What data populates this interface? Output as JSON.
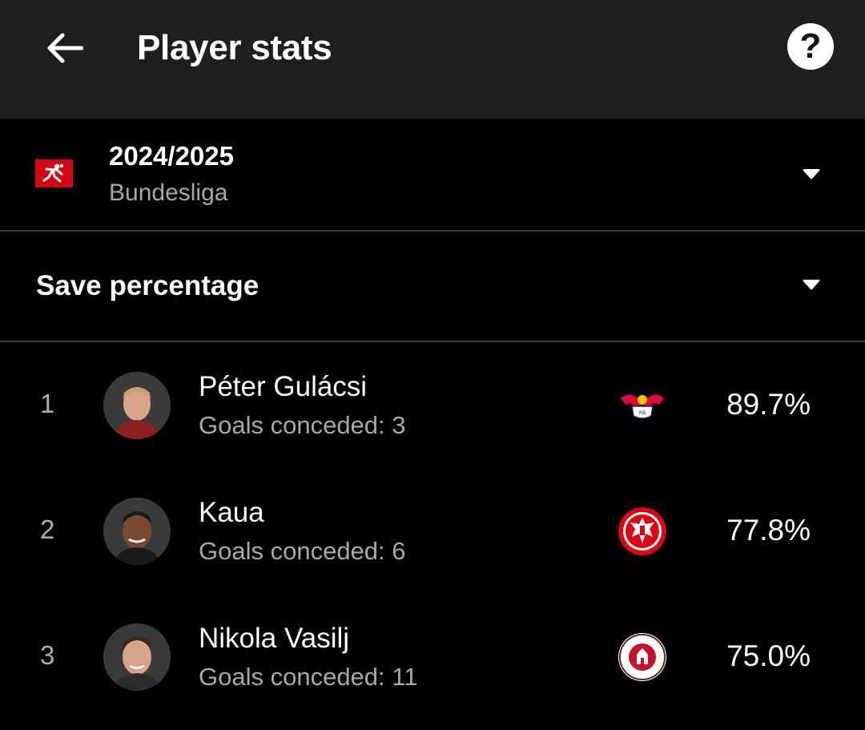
{
  "header": {
    "title": "Player stats",
    "back_icon": "arrow-left-icon",
    "help_label": "?"
  },
  "league_selector": {
    "season": "2024/2025",
    "league": "Bundesliga",
    "logo_icon": "bundesliga-logo",
    "logo_color": "#d20515"
  },
  "stat_selector": {
    "label": "Save percentage"
  },
  "players": [
    {
      "rank": "1",
      "name": "Péter Gulácsi",
      "subtitle": "Goals conceded: 3",
      "value": "89.7%",
      "club_icon": "rb-leipzig-crest"
    },
    {
      "rank": "2",
      "name": "Kaua",
      "subtitle": "Goals conceded: 6",
      "value": "77.8%",
      "club_icon": "eintracht-frankfurt-crest"
    },
    {
      "rank": "3",
      "name": "Nikola Vasilj",
      "subtitle": "Goals conceded: 11",
      "value": "75.0%",
      "club_icon": "fc-st-pauli-crest"
    }
  ],
  "colors": {
    "appbar": "#1e1e1e",
    "background": "#000000",
    "secondary_text": "#a8a8a8",
    "divider": "#3a3a3a"
  }
}
